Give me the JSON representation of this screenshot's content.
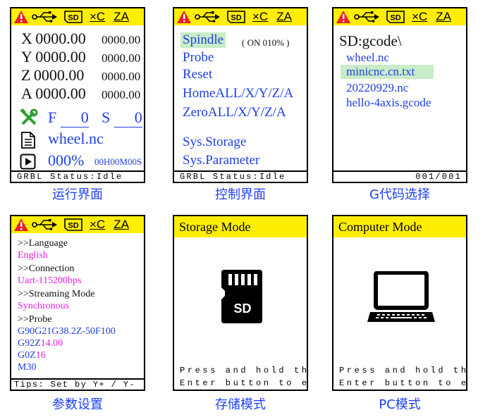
{
  "topbar": {
    "icons": [
      "warning-icon",
      "usb-icon",
      "sd-card-icon",
      "x-clear-icon",
      "z-axis-icon"
    ],
    "sd_label": "SD",
    "x_label": "×C",
    "z_label": "ZA"
  },
  "run_screen": {
    "caption": "运行界面",
    "coords": [
      {
        "axis": "X",
        "work": "0000.00",
        "machine": "0000.00"
      },
      {
        "axis": "Y",
        "work": "0000.00",
        "machine": "0000.00"
      },
      {
        "axis": "Z",
        "work": "0000.00",
        "machine": "0000.00"
      },
      {
        "axis": "A",
        "work": "0000.00",
        "machine": "0000.00"
      }
    ],
    "feed_label": "F",
    "feed_value": "0",
    "spindle_label": "S",
    "spindle_value": "0",
    "file_name": "wheel.nc",
    "progress": "000%",
    "elapsed": "00H00M00S",
    "status": "GRBL Status:Idle"
  },
  "control_screen": {
    "caption": "控制界面",
    "items": [
      "Spindle",
      "Probe",
      "Reset",
      "HomeALL/X/Y/Z/A",
      "ZeroALL/X/Y/Z/A",
      "Sys.Storage",
      "Sys.Parameter"
    ],
    "spindle_state": "( ON 010% )",
    "status": "GRBL Status:Idle"
  },
  "gcode_screen": {
    "caption": "G代码选择",
    "path": "SD:gcode\\",
    "files": [
      "wheel.nc",
      "minicnc.cn.txt",
      "20220929.nc",
      "hello-4axis.gcode"
    ],
    "page": "001/001"
  },
  "param_screen": {
    "caption": "参数设置",
    "language_label": ">>Language",
    "language_value": "English",
    "connection_label": ">>Connection",
    "connection_value": "Uart-115200bps",
    "streaming_label": ">>Streaming Mode",
    "streaming_value": "Synchronous",
    "probe_label": ">>Probe",
    "probe_line1": "G90G21G38.2Z-50F100",
    "probe_line2_prefix": "G92Z",
    "probe_line2_value": "14.00",
    "probe_line3_prefix": "G0Z",
    "probe_line3_value": "16",
    "probe_line4": "M30",
    "tips": "Tips: Set by Y+ / Y-"
  },
  "storage_screen": {
    "caption": "存储模式",
    "title": "Storage Mode",
    "sd_text": "SD",
    "hint_line1": "Press and hold the",
    "hint_line2": "Enter button to exit"
  },
  "pc_screen": {
    "caption": "PC模式",
    "title": "Computer Mode",
    "hint_line1": "Press and hold the",
    "hint_line2": "Enter button to exit"
  },
  "colors": {
    "topbar": "#ffee00",
    "text_blue": "#1f3fe0",
    "highlight": "#c9ecc9",
    "magenta": "#e51ee5",
    "warning_red": "#e8202a",
    "caption_blue": "#1e40ff"
  }
}
